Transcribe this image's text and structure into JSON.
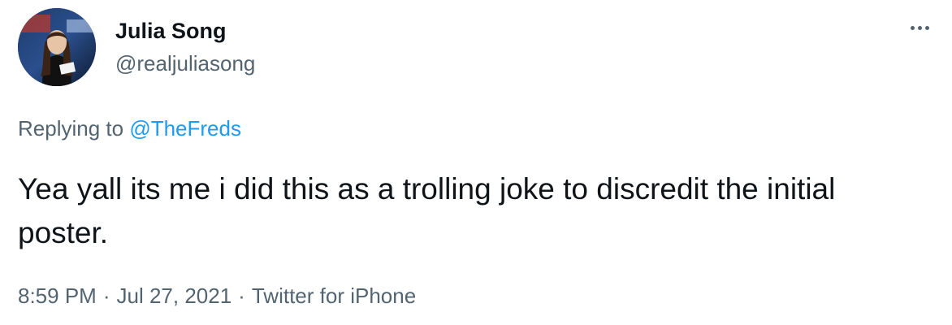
{
  "author": {
    "display_name": "Julia Song",
    "handle": "@realjuliasong",
    "avatar": "profile-photo"
  },
  "more_menu": {
    "icon": "more-horizontal-icon"
  },
  "reply_context": {
    "prefix": "Replying to",
    "mention": "@TheFreds"
  },
  "tweet": {
    "text": "Yea yall its me i did this as a trolling joke to discredit the initial poster."
  },
  "meta": {
    "time": "8:59 PM",
    "separator": "·",
    "date": "Jul 27, 2021",
    "source": "Twitter for iPhone"
  },
  "colors": {
    "text_primary": "#0f1419",
    "text_secondary": "#536471",
    "accent_link": "#1d9bf0"
  }
}
